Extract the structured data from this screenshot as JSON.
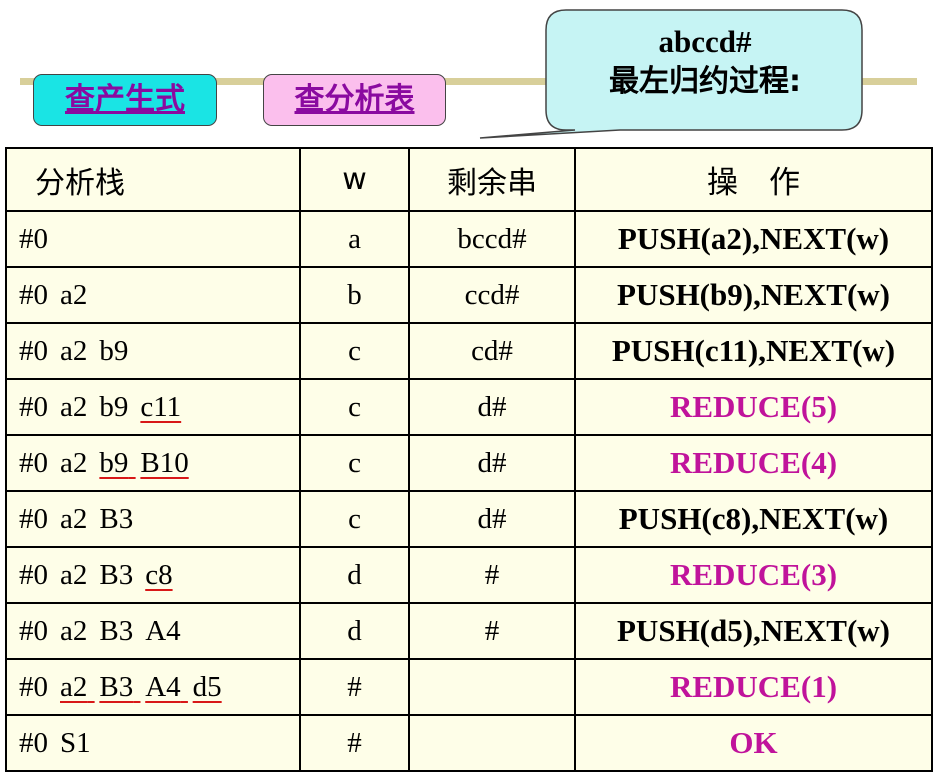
{
  "buttons": {
    "productions": "查产生式",
    "analysis_table": "查分析表"
  },
  "callout": {
    "line1": "abccd#",
    "line2": "最左归约过程:"
  },
  "table": {
    "headers": [
      "分析栈",
      "w",
      "剩余串",
      "操　作"
    ],
    "rows": [
      {
        "stack": [
          "#0"
        ],
        "underline_from": -1,
        "w": "a",
        "rest": "bccd#",
        "op": "PUSH(a2),NEXT(w)",
        "op_type": "push"
      },
      {
        "stack": [
          "#0",
          "a2"
        ],
        "underline_from": -1,
        "w": "b",
        "rest": "ccd#",
        "op": "PUSH(b9),NEXT(w)",
        "op_type": "push"
      },
      {
        "stack": [
          "#0",
          "a2",
          "b9"
        ],
        "underline_from": -1,
        "w": "c",
        "rest": "cd#",
        "op": "PUSH(c11),NEXT(w)",
        "op_type": "push"
      },
      {
        "stack": [
          "#0",
          "a2",
          "b9",
          "c11"
        ],
        "underline_from": 3,
        "w": "c",
        "rest": "d#",
        "op": "REDUCE(5)",
        "op_type": "reduce"
      },
      {
        "stack": [
          "#0",
          "a2",
          "b9",
          "B10"
        ],
        "underline_from": 2,
        "w": "c",
        "rest": "d#",
        "op": "REDUCE(4)",
        "op_type": "reduce"
      },
      {
        "stack": [
          "#0",
          "a2",
          "B3"
        ],
        "underline_from": -1,
        "w": "c",
        "rest": "d#",
        "op": "PUSH(c8),NEXT(w)",
        "op_type": "push"
      },
      {
        "stack": [
          "#0",
          "a2",
          "B3",
          "c8"
        ],
        "underline_from": 3,
        "w": "d",
        "rest": "#",
        "op": "REDUCE(3)",
        "op_type": "reduce"
      },
      {
        "stack": [
          "#0",
          "a2",
          "B3",
          "A4"
        ],
        "underline_from": -1,
        "w": "d",
        "rest": "#",
        "op": "PUSH(d5),NEXT(w)",
        "op_type": "push"
      },
      {
        "stack": [
          "#0",
          "a2",
          "B3",
          "A4",
          "d5"
        ],
        "underline_from": 1,
        "w": "#",
        "rest": "",
        "op": "REDUCE(1)",
        "op_type": "reduce"
      },
      {
        "stack": [
          "#0",
          "S1"
        ],
        "underline_from": -1,
        "w": "#",
        "rest": "",
        "op": "OK",
        "op_type": "reduce"
      }
    ]
  }
}
